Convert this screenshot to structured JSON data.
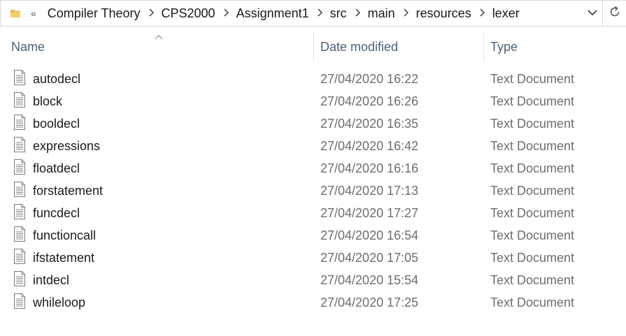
{
  "address_bar": {
    "overflow_symbol": "«",
    "crumbs": [
      "Compiler Theory",
      "CPS2000",
      "Assignment1",
      "src",
      "main",
      "resources",
      "lexer"
    ]
  },
  "columns": {
    "name": "Name",
    "date_modified": "Date modified",
    "type": "Type"
  },
  "icons": {
    "folder": "folder-icon",
    "file": "text-document-icon",
    "dropdown": "chevron-down-icon",
    "refresh": "refresh-icon",
    "sort": "sort-ascending-icon"
  },
  "files": [
    {
      "name": "autodecl",
      "date": "27/04/2020 16:22",
      "type": "Text Document"
    },
    {
      "name": "block",
      "date": "27/04/2020 16:26",
      "type": "Text Document"
    },
    {
      "name": "booldecl",
      "date": "27/04/2020 16:35",
      "type": "Text Document"
    },
    {
      "name": "expressions",
      "date": "27/04/2020 16:42",
      "type": "Text Document"
    },
    {
      "name": "floatdecl",
      "date": "27/04/2020 16:16",
      "type": "Text Document"
    },
    {
      "name": "forstatement",
      "date": "27/04/2020 17:13",
      "type": "Text Document"
    },
    {
      "name": "funcdecl",
      "date": "27/04/2020 17:27",
      "type": "Text Document"
    },
    {
      "name": "functioncall",
      "date": "27/04/2020 16:54",
      "type": "Text Document"
    },
    {
      "name": "ifstatement",
      "date": "27/04/2020 17:05",
      "type": "Text Document"
    },
    {
      "name": "intdecl",
      "date": "27/04/2020 15:54",
      "type": "Text Document"
    },
    {
      "name": "whileloop",
      "date": "27/04/2020 17:25",
      "type": "Text Document"
    }
  ]
}
